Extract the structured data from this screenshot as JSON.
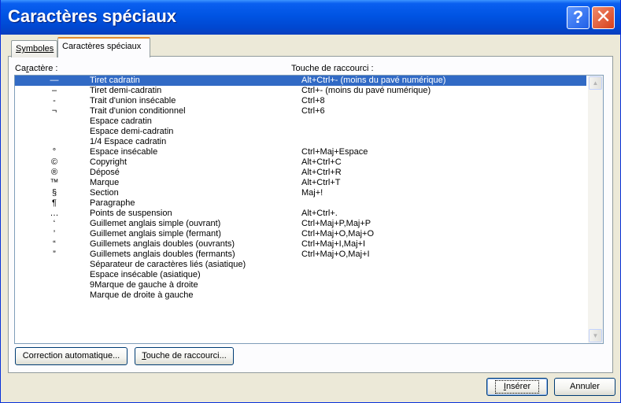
{
  "window": {
    "title": "Caractères spéciaux"
  },
  "titlebar": {
    "help_glyph": "?",
    "close_glyph": "✕"
  },
  "tabs": [
    {
      "label": "Symboles",
      "selected": false
    },
    {
      "label": "Caractères spéciaux",
      "selected": true
    }
  ],
  "columns": {
    "character_pre": "Ca",
    "character_accel": "r",
    "character_post": "actère :",
    "shortcut": "Touche de raccourci :"
  },
  "rows": [
    {
      "char": "—",
      "name": "Tiret cadratin",
      "key": "Alt+Ctrl+- (moins du pavé numérique)",
      "selected": true
    },
    {
      "char": "–",
      "name": "Tiret demi-cadratin",
      "key": "Ctrl+- (moins du pavé numérique)"
    },
    {
      "char": "-",
      "name": "Trait d'union insécable",
      "key": "Ctrl+8"
    },
    {
      "char": "¬",
      "name": "Trait d'union conditionnel",
      "key": "Ctrl+6"
    },
    {
      "char": "",
      "name": "Espace cadratin",
      "key": ""
    },
    {
      "char": "",
      "name": "Espace demi-cadratin",
      "key": ""
    },
    {
      "char": "",
      "name": "1/4 Espace cadratin",
      "key": ""
    },
    {
      "char": "°",
      "name": "Espace insécable",
      "key": "Ctrl+Maj+Espace"
    },
    {
      "char": "©",
      "name": "Copyright",
      "key": "Alt+Ctrl+C"
    },
    {
      "char": "®",
      "name": "Déposé",
      "key": "Alt+Ctrl+R"
    },
    {
      "char": "™",
      "name": "Marque",
      "key": "Alt+Ctrl+T"
    },
    {
      "char": "§",
      "name": "Section",
      "key": "Maj+!"
    },
    {
      "char": "¶",
      "name": "Paragraphe",
      "key": ""
    },
    {
      "char": "…",
      "name": "Points de suspension",
      "key": "Alt+Ctrl+."
    },
    {
      "char": "‘",
      "name": "Guillemet anglais simple (ouvrant)",
      "key": "Ctrl+Maj+P,Maj+P"
    },
    {
      "char": "’",
      "name": "Guillemet anglais simple (fermant)",
      "key": "Ctrl+Maj+O,Maj+O"
    },
    {
      "char": "“",
      "name": "Guillemets anglais doubles (ouvrants)",
      "key": "Ctrl+Maj+I,Maj+I"
    },
    {
      "char": "”",
      "name": "Guillemets anglais doubles (fermants)",
      "key": "Ctrl+Maj+O,Maj+I"
    },
    {
      "char": "",
      "name": "Séparateur de caractères liés (asiatique)",
      "key": ""
    },
    {
      "char": "",
      "name": "Espace insécable (asiatique)",
      "key": ""
    },
    {
      "char": "",
      "name": "9Marque de gauche à droite",
      "key": ""
    },
    {
      "char": "",
      "name": "Marque de droite à gauche",
      "key": ""
    }
  ],
  "buttons": {
    "autocorrect": "Correction automatique...",
    "shortcut_pre": "",
    "shortcut_accel": "T",
    "shortcut_post": "ouche de raccourci...",
    "insert_pre": "",
    "insert_accel": "I",
    "insert_post": "nsérer",
    "cancel": "Annuler"
  },
  "scrollbar": {
    "up_glyph": "▲",
    "down_glyph": "▼"
  }
}
